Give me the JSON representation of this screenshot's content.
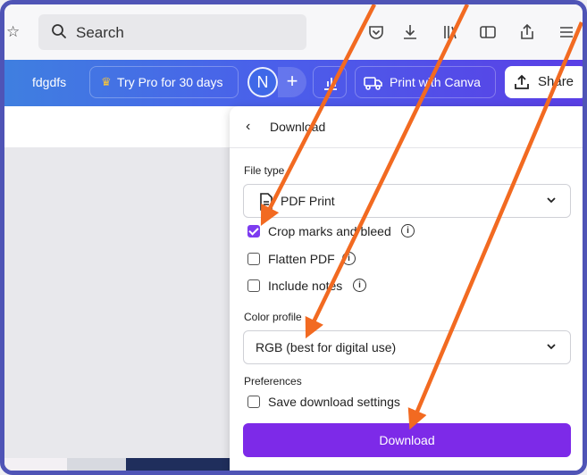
{
  "browser": {
    "search_placeholder": "Search",
    "icons": [
      "bookmark-star-icon",
      "search-icon",
      "pocket-icon",
      "download-icon",
      "library-icon",
      "reader-view-icon",
      "share-icon",
      "menu-icon"
    ]
  },
  "header": {
    "doc_name": "fdgdfs",
    "try_pro_label": "Try Pro for 30 days",
    "avatar_letter": "N",
    "add_label": "+",
    "print_label": "Print with Canva",
    "share_label": "Share"
  },
  "panel": {
    "title": "Download",
    "file_type_label": "File type",
    "file_type_value": "PDF Print",
    "options": [
      {
        "label": "Crop marks and bleed",
        "checked": true
      },
      {
        "label": "Flatten PDF",
        "checked": false
      },
      {
        "label": "Include notes",
        "checked": false
      }
    ],
    "color_profile_label": "Color profile",
    "color_profile_value": "RGB (best for digital use)",
    "preferences_label": "Preferences",
    "save_settings_label": "Save download settings",
    "save_settings_checked": false,
    "download_label": "Download"
  },
  "colors": {
    "accent": "#7d2ae8",
    "arrow": "#f26a21",
    "frame": "#4f54b6"
  }
}
